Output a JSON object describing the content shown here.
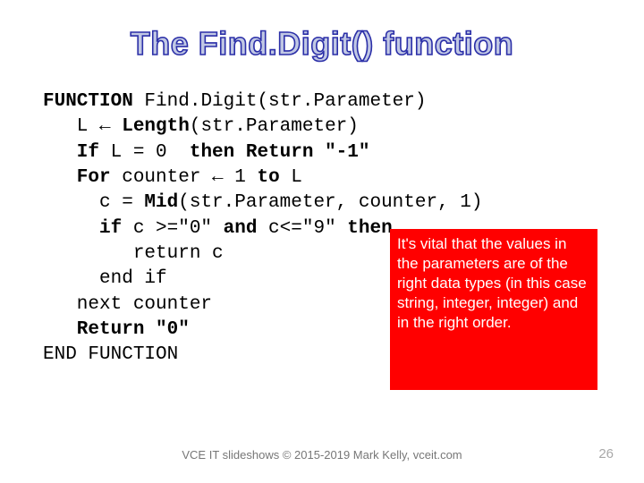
{
  "title": "The Find.Digit() function",
  "code": {
    "l1a": "FUNCTION",
    "l1b": " Find.Digit(str.Parameter)",
    "l2a": "   L ",
    "l2arrow": "←",
    "l2b": " Length",
    "l2c": "(str.Parameter)",
    "l3a": "   If",
    "l3b": " L = 0  ",
    "l3c": "then Return \"-1\"",
    "l4a": "   For",
    "l4b": " counter ",
    "l4arrow": "←",
    "l4c": " 1 ",
    "l4d": "to",
    "l4e": " L",
    "l5a": "     c = ",
    "l5b": "Mid",
    "l5c": "(str.Parameter, counter, 1)",
    "l6a": "     if",
    "l6b": " c >=\"0\" ",
    "l6c": "and",
    "l6d": " c<=\"9\" ",
    "l6e": "then",
    "l7": "        return c",
    "l8": "     end if",
    "l9": "   next counter",
    "l10a": "   Return \"0\"",
    "l11": "END FUNCTION"
  },
  "callout": "It's vital that the values in the parameters are of the right data types (in this case string, integer, integer) and in the right order.",
  "footer": "VCE IT slideshows © 2015-2019 Mark Kelly, vceit.com",
  "page_number": "26"
}
